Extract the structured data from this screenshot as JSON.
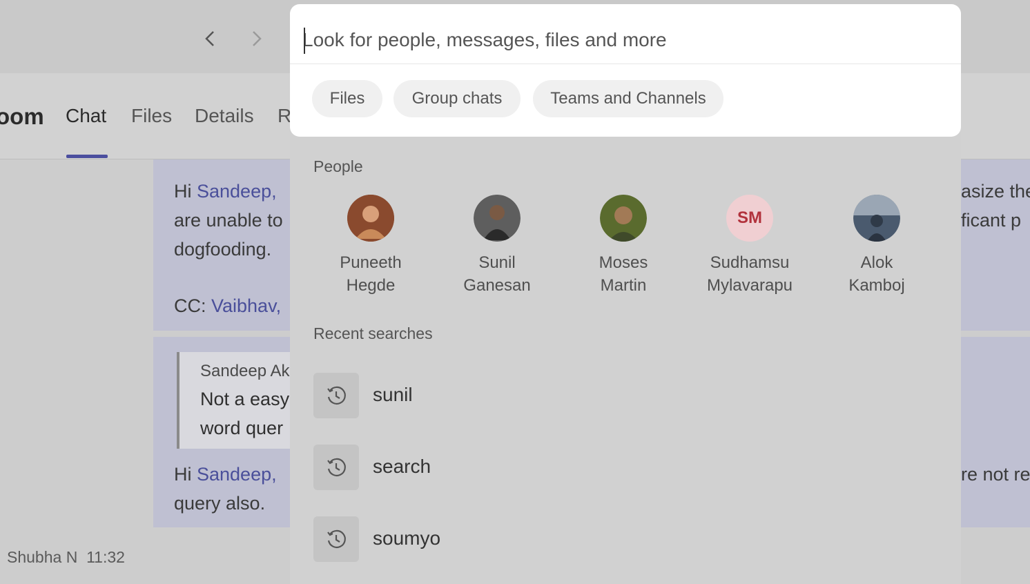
{
  "nav": {
    "back_icon": "chevron-left-icon",
    "forward_icon": "chevron-right-icon"
  },
  "header": {
    "room_title_fragment": "oom",
    "tabs": [
      {
        "label": "Chat",
        "active": true
      },
      {
        "label": "Files",
        "active": false
      },
      {
        "label": "Details",
        "active": false
      },
      {
        "label": "R",
        "active": false
      }
    ]
  },
  "chat": {
    "message1": {
      "greeting": "Hi ",
      "mention": "Sandeep,",
      "line2": "are unable to",
      "line3": "dogfooding.",
      "cc_prefix": "CC: ",
      "cc_mention": "Vaibhav,"
    },
    "quote": {
      "author": "Sandeep Ak",
      "line1": "Not a easy",
      "line2": "word quer"
    },
    "message2": {
      "greeting": "Hi ",
      "mention": "Sandeep,",
      "line2": "query also."
    },
    "footer": {
      "author": "Shubha N",
      "time": "11:32"
    },
    "right_fragments": {
      "line1": "asize the",
      "line2": "ficant p",
      "line3": "re not re"
    }
  },
  "search": {
    "placeholder": "Look for people, messages, files and more",
    "chips": [
      "Files",
      "Group chats",
      "Teams and Channels"
    ],
    "people_label": "People",
    "people": [
      {
        "first": "Puneeth",
        "last": "Hegde",
        "avatar_color": "#8a4a2e"
      },
      {
        "first": "Sunil",
        "last": "Ganesan",
        "avatar_color": "#3a3a3a"
      },
      {
        "first": "Moses",
        "last": "Martin",
        "avatar_color": "#5a6b2e"
      },
      {
        "first": "Sudhamsu",
        "last": "Mylavarapu",
        "initials": "SM"
      },
      {
        "first": "Alok",
        "last": "Kamboj",
        "avatar_color": "#4a5a6e"
      }
    ],
    "recent_label": "Recent searches",
    "recent": [
      "sunil",
      "search",
      "soumyo"
    ],
    "recent_icon": "history-icon"
  },
  "colors": {
    "accent": "#4b4e9e",
    "mention": "#4a4f9a",
    "avatar_initials_bg": "#f0cfd2",
    "avatar_initials_fg": "#b1323c"
  }
}
